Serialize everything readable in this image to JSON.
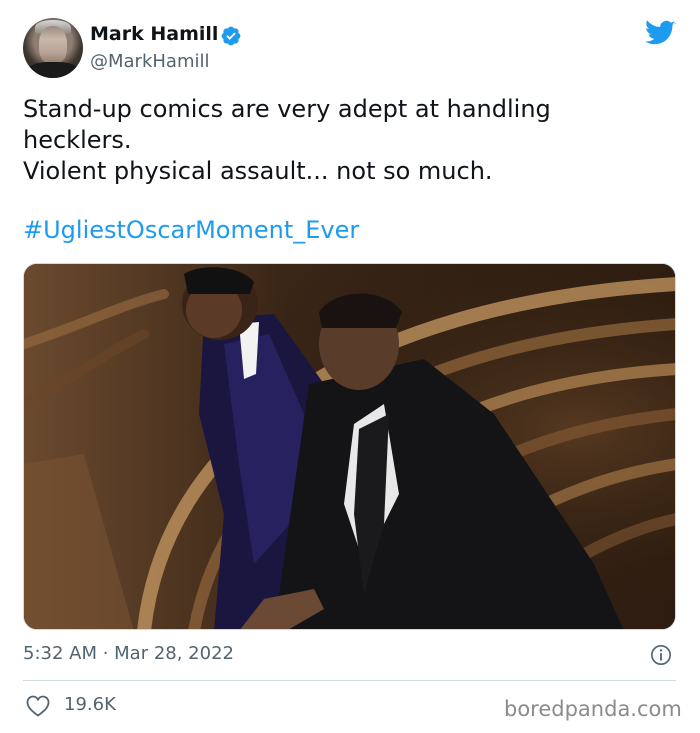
{
  "tweet": {
    "author_name": "Mark Hamill",
    "author_handle": "@MarkHamill",
    "avatar_icon": "profile-photo-icon",
    "verified_icon": "verified-badge-icon",
    "brand_icon": "twitter-bird-icon",
    "brand_color": "#1d9bf0",
    "text_lines": [
      "Stand-up comics are very adept at handling",
      "hecklers.",
      "Violent physical assault... not so much."
    ],
    "hashtag": "#UgliestOscarMoment_Ever",
    "timestamp": "5:32 AM · Mar 28, 2022",
    "likes": "19.6K",
    "like_icon": "heart-icon",
    "info_icon": "info-icon"
  },
  "watermark": "boredpanda.com"
}
